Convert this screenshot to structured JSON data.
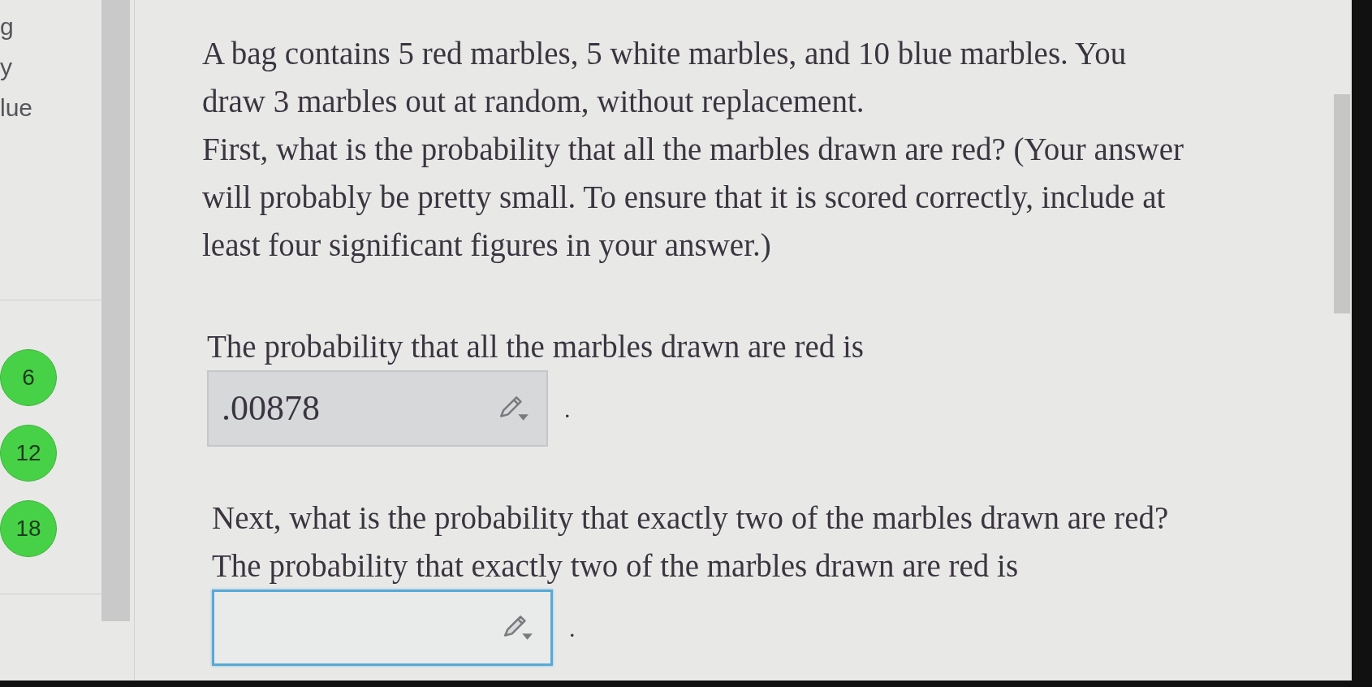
{
  "sidebar": {
    "labels": [
      "g",
      "y",
      "lue"
    ],
    "badges": [
      "6",
      "12",
      "18"
    ]
  },
  "question": {
    "paragraphs": [
      "A bag contains 5 red marbles, 5 white marbles, and 10 blue marbles. You draw 3 marbles out at random, without replacement.",
      "First, what is the probability that all the marbles drawn are red? (Your answer will probably be pretty small. To ensure that it is scored correctly, include at least four significant figures in your answer.)"
    ]
  },
  "parts": [
    {
      "prompt": "The probability that all the marbles drawn are red is",
      "answer": {
        "focused": false,
        "value": ".00878"
      },
      "after": "."
    },
    {
      "question": "Next, what is the probability that exactly two of the marbles drawn are red?",
      "prompt": "The probability that exactly two of the marbles drawn are red is",
      "answer": {
        "focused": true
      },
      "after": "."
    }
  ]
}
